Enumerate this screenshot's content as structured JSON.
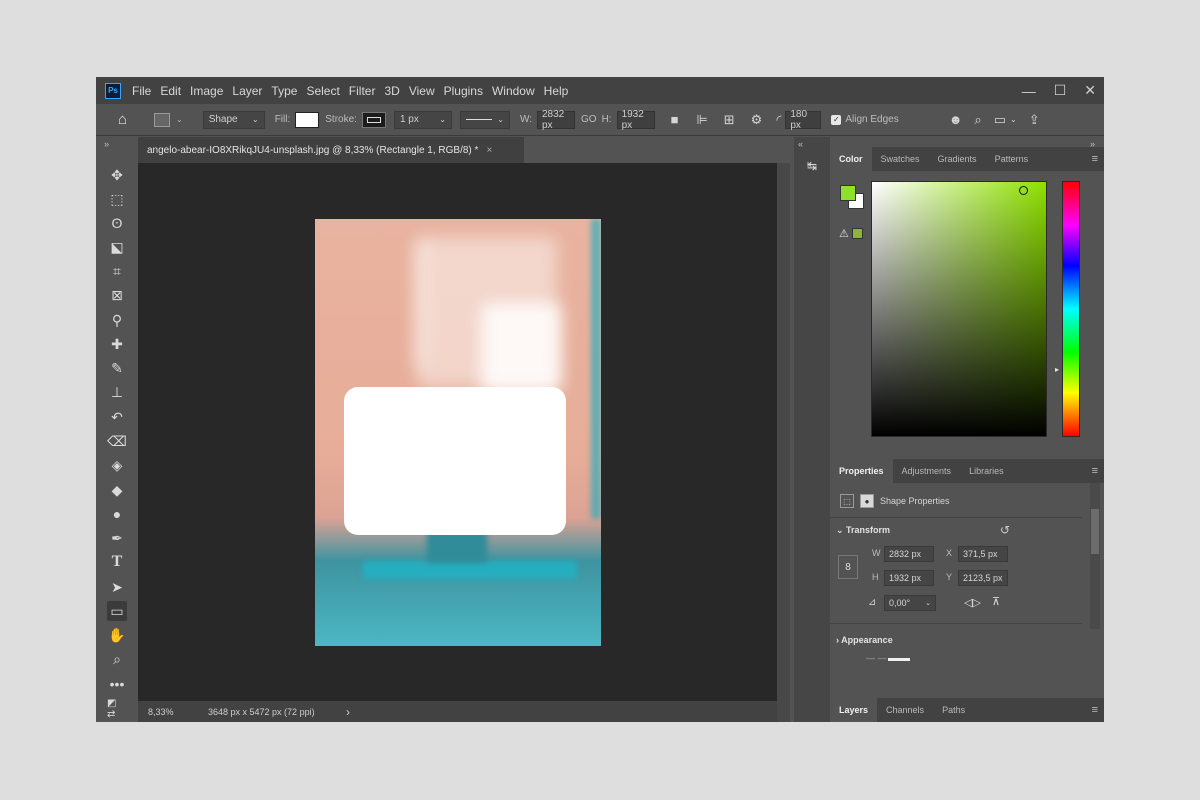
{
  "app": {
    "logo": "Ps",
    "menu": [
      "File",
      "Edit",
      "Image",
      "Layer",
      "Type",
      "Select",
      "Filter",
      "3D",
      "View",
      "Plugins",
      "Window",
      "Help"
    ],
    "window_controls": {
      "minimize": "—",
      "maximize": "☐",
      "close": "✕"
    }
  },
  "options": {
    "tool_mode": "Shape",
    "fill_label": "Fill:",
    "stroke_label": "Stroke:",
    "stroke_width": "1 px",
    "w_label": "W:",
    "w_value": "2832 px",
    "link_label": "GO",
    "h_label": "H:",
    "h_value": "1932 px",
    "radius_value": "180 px",
    "align_edges": "Align Edges",
    "fill_color": "#ffffff"
  },
  "tools": [
    "move",
    "marquee",
    "lasso",
    "object-select",
    "crop",
    "frame",
    "eyedropper",
    "healing",
    "brush",
    "clone-stamp",
    "history-brush",
    "eraser",
    "paint-bucket",
    "blur",
    "dodge",
    "pen",
    "type",
    "path-select",
    "rectangle",
    "hand",
    "zoom",
    "more"
  ],
  "document": {
    "tab_title": "angelo-abear-IO8XRikqJU4-unsplash.jpg @ 8,33% (Rectangle 1, RGB/8) *",
    "close": "×",
    "zoom": "8,33%",
    "dimensions": "3648 px x 5472 px (72 ppi)",
    "status_arrow": "›"
  },
  "color_panel": {
    "tabs": [
      "Color",
      "Swatches",
      "Gradients",
      "Patterns"
    ],
    "active_tab": "Color",
    "foreground": "#8ee12a",
    "background": "#ffffff",
    "gamut_warning_color": "#8cb33d",
    "hue": "#8ee100"
  },
  "properties_panel": {
    "tabs": [
      "Properties",
      "Adjustments",
      "Libraries"
    ],
    "active_tab": "Properties",
    "shape_label": "Shape Properties",
    "transform": {
      "title": "Transform",
      "w_label": "W",
      "w": "2832 px",
      "x_label": "X",
      "x": "371,5 px",
      "h_label": "H",
      "h": "1932 px",
      "y_label": "Y",
      "y": "2123,5 px",
      "angle": "0,00°"
    },
    "appearance": {
      "title": "Appearance"
    }
  },
  "layers_panel": {
    "tabs": [
      "Layers",
      "Channels",
      "Paths"
    ],
    "active_tab": "Layers"
  }
}
